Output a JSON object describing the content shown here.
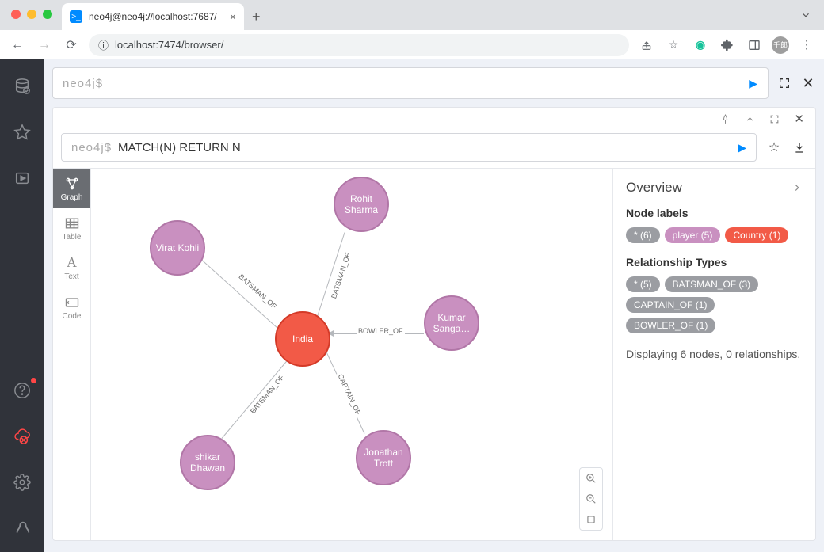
{
  "browser": {
    "tab_title": "neo4j@neo4j://localhost:7687/",
    "url": "localhost:7474/browser/",
    "avatar_text": "千郎"
  },
  "editor": {
    "prompt": "neo4j$",
    "current_query": ""
  },
  "frame": {
    "prompt": "neo4j$",
    "query": "MATCH(N) RETURN N",
    "view_tabs": {
      "graph": "Graph",
      "table": "Table",
      "text": "Text",
      "code": "Code"
    }
  },
  "graph": {
    "nodes": {
      "kohli": "Virat Kohli",
      "rohit": "Rohit Sharma",
      "sanga": "Kumar Sanga…",
      "trott": "Jonathan Trott",
      "dhawan": "shikar Dhawan",
      "india": "India"
    },
    "edges": {
      "batsman": "BATSMAN_OF",
      "bowler": "BOWLER_OF",
      "captain": "CAPTAIN_OF"
    }
  },
  "overview": {
    "title": "Overview",
    "node_labels_title": "Node labels",
    "node_labels": {
      "all": "* (6)",
      "player": "player (5)",
      "country": "Country (1)"
    },
    "rel_types_title": "Relationship Types",
    "rel_types": {
      "all": "* (5)",
      "batsman": "BATSMAN_OF (3)",
      "captain": "CAPTAIN_OF (1)",
      "bowler": "BOWLER_OF (1)"
    },
    "status": "Displaying 6 nodes, 0 relationships."
  }
}
